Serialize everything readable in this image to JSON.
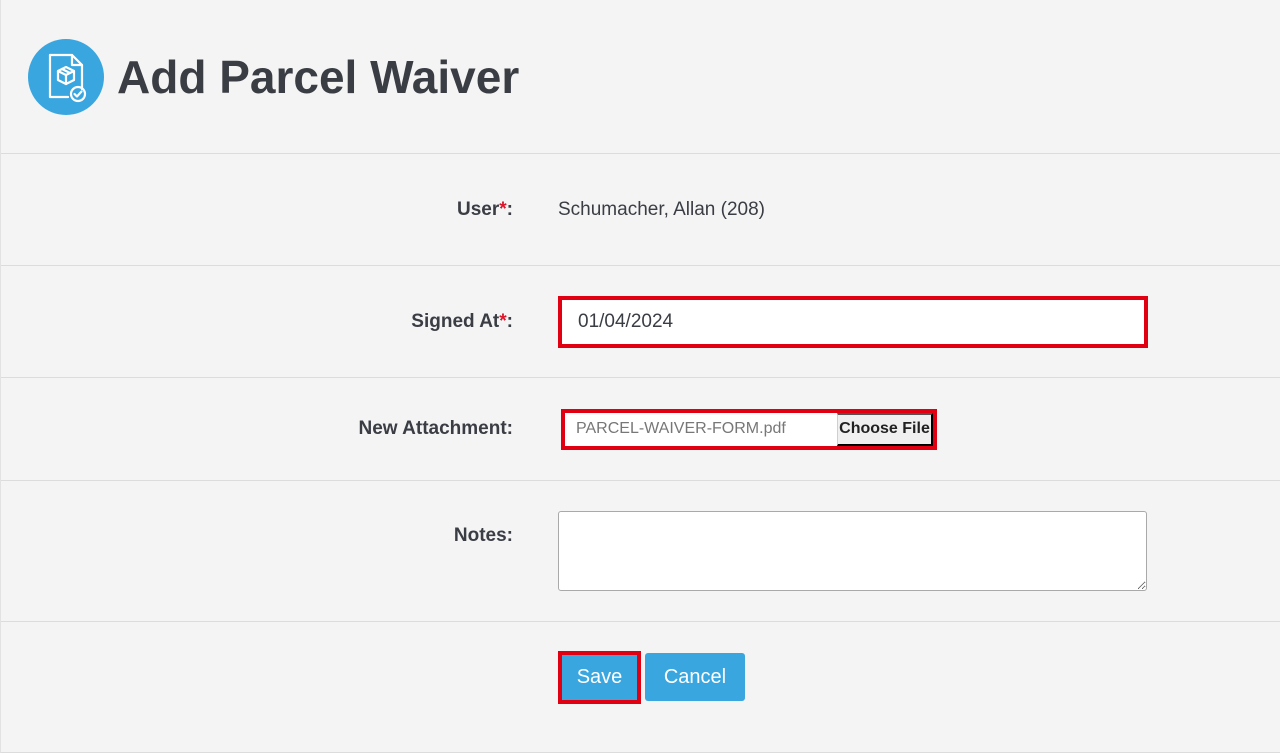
{
  "header": {
    "title": "Add Parcel Waiver",
    "icon": "parcel-waiver-icon",
    "icon_color": "#3aa6e0"
  },
  "form": {
    "user": {
      "label": "User",
      "required_mark": "*",
      "colon": ":",
      "value": "Schumacher, Allan (208)"
    },
    "signed_at": {
      "label": "Signed At",
      "required_mark": "*",
      "colon": ":",
      "value": "01/04/2024"
    },
    "attachment": {
      "label": "New Attachment:",
      "file_name": "PARCEL-WAIVER-FORM.pdf",
      "button_label": "Choose File"
    },
    "notes": {
      "label": "Notes:",
      "value": ""
    }
  },
  "actions": {
    "save_label": "Save",
    "cancel_label": "Cancel"
  },
  "colors": {
    "accent": "#3aa6e0",
    "required": "#d9162b",
    "highlight": "#e00012",
    "background": "#f4f4f4"
  }
}
